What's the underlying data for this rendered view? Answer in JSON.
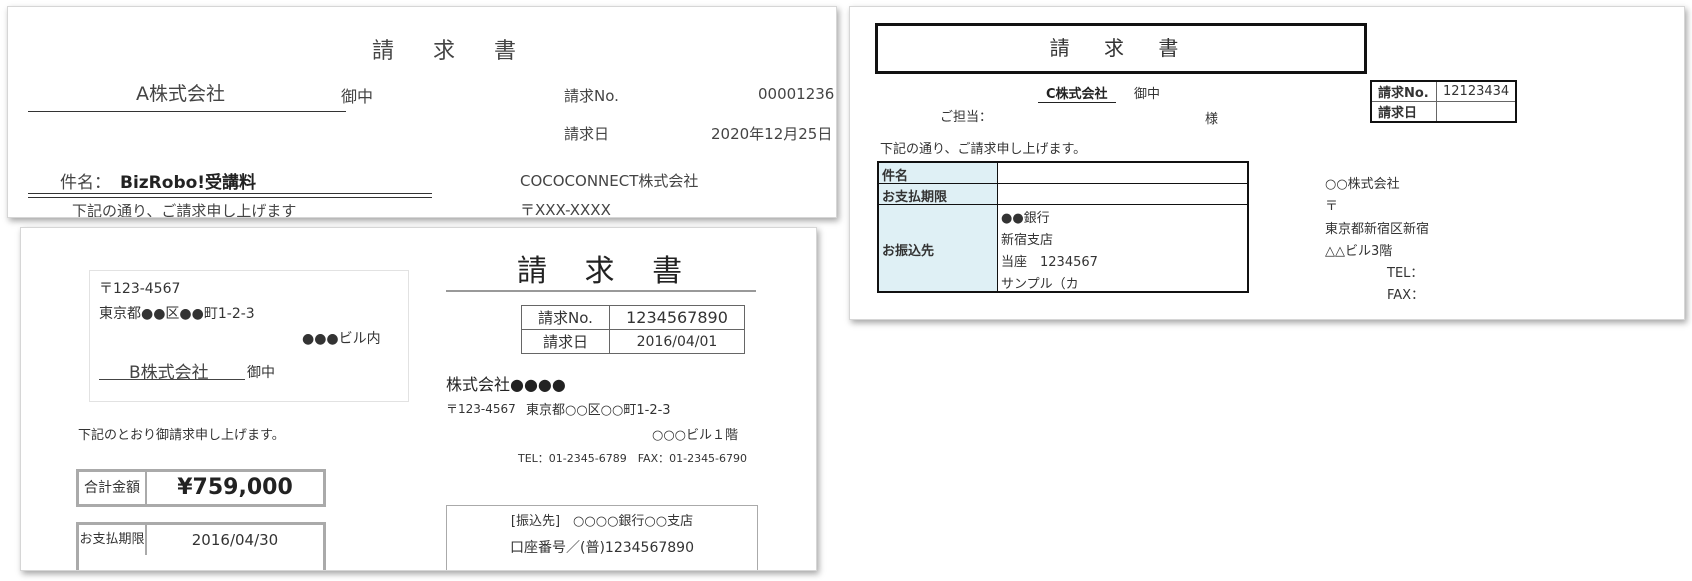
{
  "panel_a": {
    "title": "請 求 書",
    "company": "A株式会社",
    "honorific": "御中",
    "invoice_no_label": "請求No.",
    "invoice_no": "00001236",
    "date_label": "請求日",
    "date": "2020年12月25日",
    "subject_label": "件名：",
    "subject": "BizRobo!受講料",
    "issuer": "COCOCONNECT株式会社",
    "intro_partial": "下記の通り、ご請求申し上げます",
    "postal_partial": "〒XXX-XXXX"
  },
  "panel_b": {
    "postal": "〒123-4567",
    "address": "東京都●●区●●町1-2-3",
    "building": "●●●ビル内",
    "company": "B株式会社",
    "honorific": "御中",
    "title": "請 求 書",
    "invoice_no_label": "請求No.",
    "invoice_no": "1234567890",
    "date_label": "請求日",
    "date": "2016/04/01",
    "issuer_name": "株式会社●●●●",
    "issuer_postal": "〒123-4567",
    "issuer_address": "東京都○○区○○町1-2-3",
    "issuer_building": "○○○ビル１階",
    "tel_fax": "TEL：01-2345-6789　FAX：01-2345-6790",
    "intro": "下記のとおり御請求申し上げます。",
    "total_label": "合計金額",
    "total": "¥759,000",
    "due_label": "お支払期限",
    "due": "2016/04/30",
    "bank_line": "[振込先]　○○○○銀行○○支店",
    "account_line": "口座番号／(普)1234567890"
  },
  "panel_c": {
    "title": "請 求 書",
    "company": "C株式会社",
    "honorific": "御中",
    "contact_label": "ご担当：",
    "sama": "様",
    "invoice_no_label": "請求No.",
    "invoice_no": "12123434",
    "date_label": "請求日",
    "intro": "下記の通り、ご請求申し上げます。",
    "rows": {
      "subject_label": "件名",
      "due_label": "お支払期限",
      "bank_label": "お振込先",
      "bank_lines": [
        "●●銀行",
        "新宿支店",
        "当座　1234567",
        "サンプル（カ"
      ]
    },
    "issuer_lines": [
      "○○株式会社",
      "〒",
      "東京都新宿区新宿",
      "△△ビル3階"
    ],
    "tel_label": "TEL：",
    "fax_label": "FAX："
  }
}
